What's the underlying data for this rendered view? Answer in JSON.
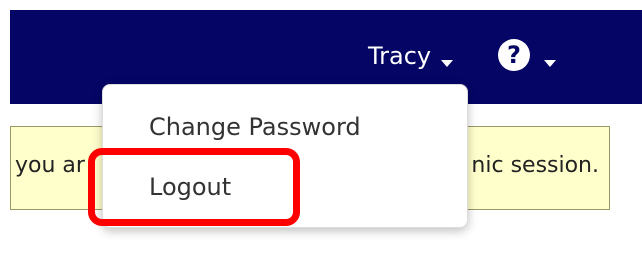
{
  "header": {
    "user_name": "Tracy",
    "help_icon_glyph": "?",
    "bg_color": "#050566"
  },
  "notice": {
    "text_left": "you ar",
    "text_right": "nic session.",
    "bg_color": "#ffffcc"
  },
  "user_dropdown": {
    "items": [
      {
        "label": "Change Password"
      },
      {
        "label": "Logout"
      }
    ]
  },
  "annotation": {
    "highlight_color": "#ff0000",
    "highlighted_item": "Logout"
  }
}
